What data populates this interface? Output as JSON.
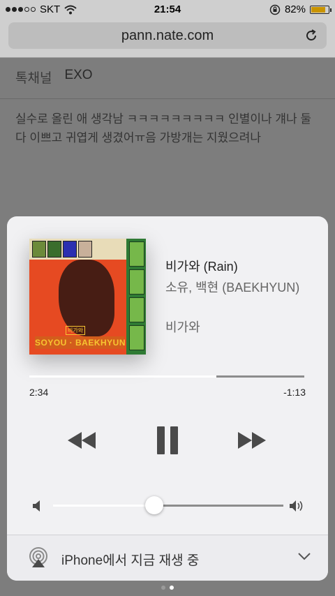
{
  "status": {
    "carrier": "SKT",
    "time": "21:54",
    "battery": "82%",
    "battery_level": 0.82
  },
  "browser": {
    "url": "pann.nate.com"
  },
  "page": {
    "channel_label": "톡채널",
    "channel_value": "EXO",
    "post_text": "실수로 올린 애 생각남 ㅋㅋㅋㅋㅋㅋㅋㅋㅋ 인별이나 걔나 둘 다 이쁘고 귀엽게 생겼어ㅠ음 가방개는 지웠으려나"
  },
  "now_playing": {
    "album_art": {
      "title_text": "SOYOU · BAEKHYUN",
      "small_text": "비가와"
    },
    "track_title": "비가와 (Rain)",
    "artist": "소유, 백현 (BAEKHYUN)",
    "album": "비가와",
    "time_elapsed": "2:34",
    "time_remaining": "-1:13",
    "progress": 0.68,
    "volume": 0.44,
    "airplay_label": "iPhone에서 지금 재생 중",
    "colors": {
      "panel_bg": "#f1f1f3",
      "track_fill": "#ffffff",
      "track_bg": "#8c8c8c",
      "icon": "#4a4a4a"
    },
    "icons": {
      "rewind": "rewind-icon",
      "pause": "pause-icon",
      "fast_forward": "fast-forward-icon",
      "volume_low": "volume-low-icon",
      "volume_high": "volume-high-icon",
      "airplay": "airplay-icon",
      "chevron": "chevron-down-icon"
    }
  },
  "pager": {
    "count": 2,
    "active": 1
  }
}
